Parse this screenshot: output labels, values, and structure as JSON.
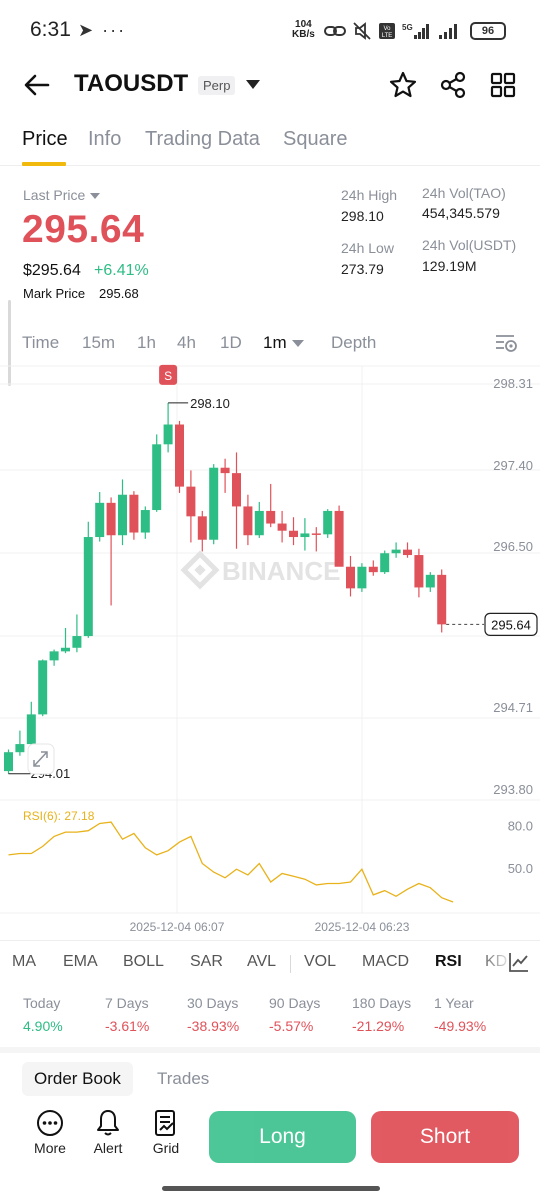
{
  "status_bar": {
    "time": "6:31",
    "left_icons": "➤ ···",
    "net_speed_value": "104",
    "net_speed_unit": "KB/s",
    "battery": "96"
  },
  "header": {
    "symbol": "TAOUSDT",
    "badge": "Perp",
    "icons": [
      "back-arrow-icon",
      "star-icon",
      "share-icon",
      "grid-icon"
    ]
  },
  "tabs": [
    "Price",
    "Info",
    "Trading Data",
    "Square"
  ],
  "ticker": {
    "last_price_label": "Last Price",
    "last_price": "295.64",
    "usd_price": "$295.64",
    "change_pct": "+6.41%",
    "mark_price_label": "Mark Price",
    "mark_price": "295.68",
    "high_label": "24h High",
    "high": "298.10",
    "low_label": "24h Low",
    "low": "273.79",
    "vol_base_label": "24h Vol(TAO)",
    "vol_base": "454,345.579",
    "vol_quote_label": "24h Vol(USDT)",
    "vol_quote": "129.19M"
  },
  "intervals": [
    "Time",
    "15m",
    "1h",
    "4h",
    "1D",
    "1m",
    "Depth"
  ],
  "active_interval": "1m",
  "chart_data": {
    "type": "candlestick",
    "y_ticks": [
      "298.31",
      "297.40",
      "296.50",
      "295.64",
      "294.71",
      "293.80"
    ],
    "ylim": [
      293.8,
      298.31
    ],
    "current_price_label": "295.64",
    "high_marker_label": "298.10",
    "low_marker_label": "294.01",
    "signal_badge": "S",
    "watermark": "BINANCE",
    "x_ticks": [
      "2025-12-04 06:07",
      "2025-12-04 06:23"
    ],
    "candles": [
      {
        "o": 294.01,
        "h": 294.25,
        "l": 293.98,
        "c": 294.22
      },
      {
        "o": 294.22,
        "h": 294.46,
        "l": 294.18,
        "c": 294.31
      },
      {
        "o": 294.31,
        "h": 294.78,
        "l": 294.29,
        "c": 294.64
      },
      {
        "o": 294.64,
        "h": 295.25,
        "l": 294.62,
        "c": 295.24
      },
      {
        "o": 295.24,
        "h": 295.36,
        "l": 295.18,
        "c": 295.34
      },
      {
        "o": 295.34,
        "h": 295.6,
        "l": 295.32,
        "c": 295.38
      },
      {
        "o": 295.38,
        "h": 295.75,
        "l": 295.33,
        "c": 295.51
      },
      {
        "o": 295.51,
        "h": 296.78,
        "l": 295.49,
        "c": 296.61
      },
      {
        "o": 296.61,
        "h": 297.11,
        "l": 296.56,
        "c": 296.99
      },
      {
        "o": 296.99,
        "h": 297.05,
        "l": 295.85,
        "c": 296.63
      },
      {
        "o": 296.63,
        "h": 297.25,
        "l": 296.52,
        "c": 297.08
      },
      {
        "o": 297.08,
        "h": 297.12,
        "l": 296.58,
        "c": 296.66
      },
      {
        "o": 296.66,
        "h": 296.95,
        "l": 296.59,
        "c": 296.91
      },
      {
        "o": 296.91,
        "h": 297.75,
        "l": 296.89,
        "c": 297.64
      },
      {
        "o": 297.64,
        "h": 298.1,
        "l": 297.55,
        "c": 297.86
      },
      {
        "o": 297.86,
        "h": 297.9,
        "l": 297.1,
        "c": 297.17
      },
      {
        "o": 297.17,
        "h": 297.35,
        "l": 296.55,
        "c": 296.84
      },
      {
        "o": 296.84,
        "h": 296.9,
        "l": 296.45,
        "c": 296.58
      },
      {
        "o": 296.58,
        "h": 297.42,
        "l": 296.53,
        "c": 297.38
      },
      {
        "o": 297.38,
        "h": 297.48,
        "l": 297.1,
        "c": 297.32
      },
      {
        "o": 297.32,
        "h": 297.55,
        "l": 296.48,
        "c": 296.95
      },
      {
        "o": 296.95,
        "h": 297.08,
        "l": 296.52,
        "c": 296.63
      },
      {
        "o": 296.63,
        "h": 297.0,
        "l": 296.6,
        "c": 296.9
      },
      {
        "o": 296.9,
        "h": 297.2,
        "l": 296.72,
        "c": 296.76
      },
      {
        "o": 296.76,
        "h": 296.9,
        "l": 296.55,
        "c": 296.68
      },
      {
        "o": 296.68,
        "h": 296.83,
        "l": 296.52,
        "c": 296.61
      },
      {
        "o": 296.61,
        "h": 296.82,
        "l": 296.46,
        "c": 296.65
      },
      {
        "o": 296.65,
        "h": 296.72,
        "l": 296.45,
        "c": 296.64
      },
      {
        "o": 296.64,
        "h": 296.92,
        "l": 296.6,
        "c": 296.9
      },
      {
        "o": 296.9,
        "h": 296.96,
        "l": 296.55,
        "c": 296.28
      },
      {
        "o": 296.28,
        "h": 296.4,
        "l": 295.95,
        "c": 296.04
      },
      {
        "o": 296.04,
        "h": 296.32,
        "l": 296.0,
        "c": 296.28
      },
      {
        "o": 296.28,
        "h": 296.35,
        "l": 296.18,
        "c": 296.22
      },
      {
        "o": 296.22,
        "h": 296.46,
        "l": 296.2,
        "c": 296.43
      },
      {
        "o": 296.43,
        "h": 296.55,
        "l": 296.38,
        "c": 296.47
      },
      {
        "o": 296.47,
        "h": 296.55,
        "l": 296.38,
        "c": 296.41
      },
      {
        "o": 296.41,
        "h": 296.48,
        "l": 295.94,
        "c": 296.05
      },
      {
        "o": 296.05,
        "h": 296.22,
        "l": 296.0,
        "c": 296.19
      },
      {
        "o": 296.19,
        "h": 296.25,
        "l": 295.55,
        "c": 295.64
      }
    ],
    "rsi": {
      "label": "RSI(6): 27.18",
      "ticks": [
        "80.0",
        "50.0"
      ],
      "ylim": [
        20,
        95
      ],
      "values": [
        60,
        61,
        61,
        66,
        73,
        76,
        76,
        77,
        82,
        83,
        71,
        75,
        65,
        60,
        63,
        69,
        73,
        54,
        48,
        44,
        50,
        46,
        54,
        41,
        47,
        45,
        43,
        39,
        40,
        40,
        41,
        50,
        32,
        35,
        31,
        36,
        40,
        37,
        30,
        27
      ]
    }
  },
  "indicators": [
    "MA",
    "EMA",
    "BOLL",
    "SAR",
    "AVL",
    "VOL",
    "MACD",
    "RSI",
    "KD"
  ],
  "active_indicator": "RSI",
  "performance": [
    {
      "label": "Today",
      "value": "4.90%",
      "dir": "up"
    },
    {
      "label": "7 Days",
      "value": "-3.61%",
      "dir": "down"
    },
    {
      "label": "30 Days",
      "value": "-38.93%",
      "dir": "down"
    },
    {
      "label": "90 Days",
      "value": "-5.57%",
      "dir": "down"
    },
    {
      "label": "180 Days",
      "value": "-21.29%",
      "dir": "down"
    },
    {
      "label": "1 Year",
      "value": "-49.93%",
      "dir": "down"
    }
  ],
  "orderbook_tabs": [
    "Order Book",
    "Trades"
  ],
  "actions": {
    "more": "More",
    "alert": "Alert",
    "grid": "Grid",
    "long": "Long",
    "short": "Short"
  },
  "colors": {
    "up": "#2ebd85",
    "down": "#e0525a",
    "accent": "#f0b90b",
    "rsi_line": "#e8b21a"
  }
}
